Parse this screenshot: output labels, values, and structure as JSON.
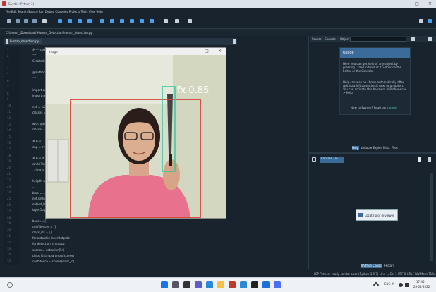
{
  "app": {
    "title": "Spyder (Python 3)",
    "menu": "File  Edit  Search  Source  Run  Debug  Consoles  Projects  Tools  View  Help"
  },
  "toolbar": {
    "path_value": "C:\\Users\\_\\Downloads\\Human_Detection"
  },
  "editor": {
    "path": "C:\\Users\\_\\Downloads\\Human_Detection\\human_detection.py",
    "tab_label": "human_detection.py",
    "line_numbers": [
      "1",
      "2",
      "3",
      "4",
      "5",
      "6",
      "7",
      "8",
      "9",
      "10",
      "11",
      "12",
      "13",
      "14",
      "15",
      "16",
      "17",
      "18",
      "19",
      "20",
      "21",
      "22",
      "23",
      "24",
      "25",
      "26",
      "27",
      "28",
      "29",
      "30",
      "31",
      "32",
      "33",
      "34",
      "35"
    ],
    "code_lines": [
      "# -*- coding: utf-8 -*-",
      "\"\"\"",
      "Created on ...",
      "",
      "@author: ...",
      "\"\"\"",
      "",
      "import cv2",
      "import numpy as np",
      "",
      "net = cv2.dnn.readNet(...)",
      "classes = []",
      "",
      "with open(...) as f:",
      "    classes = ...",
      "",
      "# Run",
      "cap = cv2.VideoCapture(0)",
      "",
      "# Run it",
      "while True:",
      "    _, img = cap.read()",
      "    ...",
      "    height, width, _ = img.shape",
      "    ...",
      "    blob = ...",
      "    net.setInput(blob)",
      "    output_layers_names = ...",
      "    layerOutputs = ...",
      "",
      "    boxes = []",
      "    confidences = []",
      "    class_ids = []",
      "    for output in layerOutputs:",
      "        for detection in output:",
      "            scores = detection[5:]",
      "            class_id = np.argmax(scores)",
      "            confidence = scores[class_id]"
    ]
  },
  "image_window": {
    "title": "Image",
    "detection_label": "fx 0.85"
  },
  "help_panel": {
    "tabs": [
      "Source",
      "Console",
      "Object"
    ],
    "card_title": "Usage",
    "card_text_1": "Here you can get help of any object by pressing Ctrl+I in front of it, either on the Editor or the Console.",
    "card_text_2": "Help can also be shown automatically after writing a left parenthesis next to an object. You can activate this behavior in Preferences > Help.",
    "card_link_prefix": "New to Spyder? Read our",
    "card_link": "tutorial",
    "pane_tabs": [
      "Help",
      "Variable Explorer",
      "Plots",
      "Files"
    ]
  },
  "console": {
    "tab_label": "Console 1/A",
    "plots_button": "Locate plot in viewer",
    "bottom_tabs": [
      "IPython Console",
      "History"
    ]
  },
  "statusbar": {
    "text": "LSP Python: ready   conda: base (Python 3.9.7)   Line 1, Col 1   UTF-8   CRLF   RW   Mem 71%"
  },
  "taskbar": {
    "time": "17:45",
    "date": "28-04-2022",
    "tray": "ENG  IN"
  },
  "colors": {
    "bg": "#19232d",
    "accent": "#3a6b99",
    "bbox_person": "#d4473e",
    "bbox_knife": "#32c8a0"
  }
}
